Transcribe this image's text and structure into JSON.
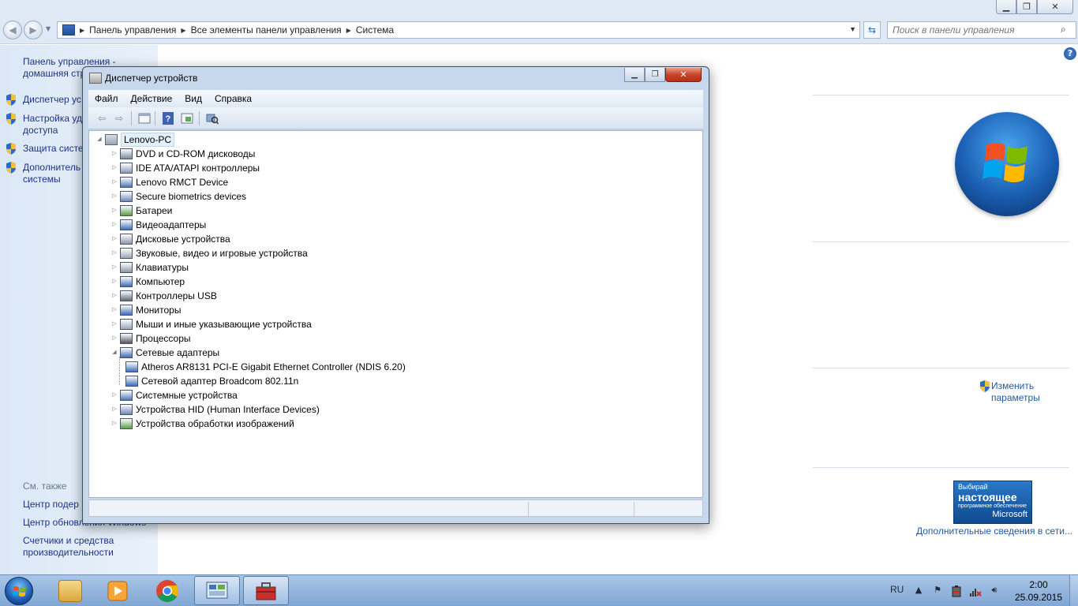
{
  "control_panel": {
    "breadcrumbs": [
      "Панель управления",
      "Все элементы панели управления",
      "Система"
    ],
    "search_placeholder": "Поиск в панели управления",
    "sidebar": {
      "home": "Панель управления - домашняя стр",
      "device_manager": "Диспетчер ус",
      "remote": "Настройка уд доступа",
      "protection": "Защита систе",
      "advanced": "Дополнитель системы",
      "see_also": "См. также",
      "support": "Центр подер",
      "update": "Центр обновления Windows",
      "performance": "Счетчики и средства производительности"
    },
    "change_params": "Изменить параметры",
    "genuine": {
      "line1": "Выбирай",
      "line2": "настоящее",
      "line3": "программное обеспечение",
      "line4": "Microsoft"
    },
    "more_info": "Дополнительные сведения в сети..."
  },
  "device_manager": {
    "title": "Диспетчер устройств",
    "menu": [
      "Файл",
      "Действие",
      "Вид",
      "Справка"
    ],
    "root": "Lenovo-PC",
    "categories": [
      {
        "label": "DVD и CD-ROM дисководы",
        "expanded": false
      },
      {
        "label": "IDE ATA/ATAPI контроллеры",
        "expanded": false
      },
      {
        "label": "Lenovo RMCT Device",
        "expanded": false
      },
      {
        "label": "Secure biometrics devices",
        "expanded": false
      },
      {
        "label": "Батареи",
        "expanded": false
      },
      {
        "label": "Видеоадаптеры",
        "expanded": false
      },
      {
        "label": "Дисковые устройства",
        "expanded": false
      },
      {
        "label": "Звуковые, видео и игровые устройства",
        "expanded": false
      },
      {
        "label": "Клавиатуры",
        "expanded": false
      },
      {
        "label": "Компьютер",
        "expanded": false
      },
      {
        "label": "Контроллеры USB",
        "expanded": false
      },
      {
        "label": "Мониторы",
        "expanded": false
      },
      {
        "label": "Мыши и иные указывающие устройства",
        "expanded": false
      },
      {
        "label": "Процессоры",
        "expanded": false
      },
      {
        "label": "Сетевые адаптеры",
        "expanded": true
      },
      {
        "label": "Atheros AR8131 PCI-E Gigabit Ethernet Controller (NDIS 6.20)",
        "child": true
      },
      {
        "label": "Сетевой адаптер Broadcom 802.11n",
        "child": true
      },
      {
        "label": "Системные устройства",
        "expanded": false
      },
      {
        "label": "Устройства HID (Human Interface Devices)",
        "expanded": false
      },
      {
        "label": "Устройства обработки изображений",
        "expanded": false
      }
    ]
  },
  "taskbar": {
    "language": "RU",
    "time": "2:00",
    "date": "25.09.2015"
  },
  "colors": {
    "link": "#1e5aa8",
    "sidebar_text": "#1e3287",
    "close_button": "#c8432a"
  }
}
